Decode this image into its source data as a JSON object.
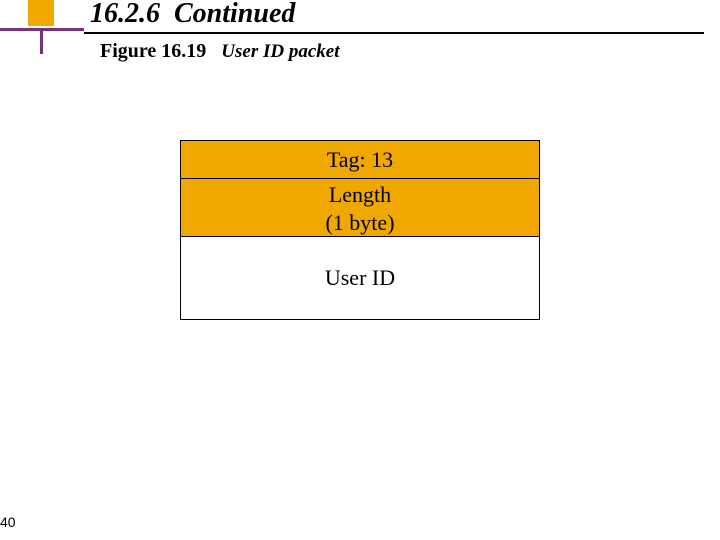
{
  "header": {
    "section_number": "16.2.6",
    "section_word": "Continued"
  },
  "figure": {
    "label": "Figure 16.19",
    "title": "User ID packet"
  },
  "packet": {
    "tag": "Tag: 13",
    "length_line1": "Length",
    "length_line2": "(1 byte)",
    "body": "User ID"
  },
  "page_number": "40"
}
